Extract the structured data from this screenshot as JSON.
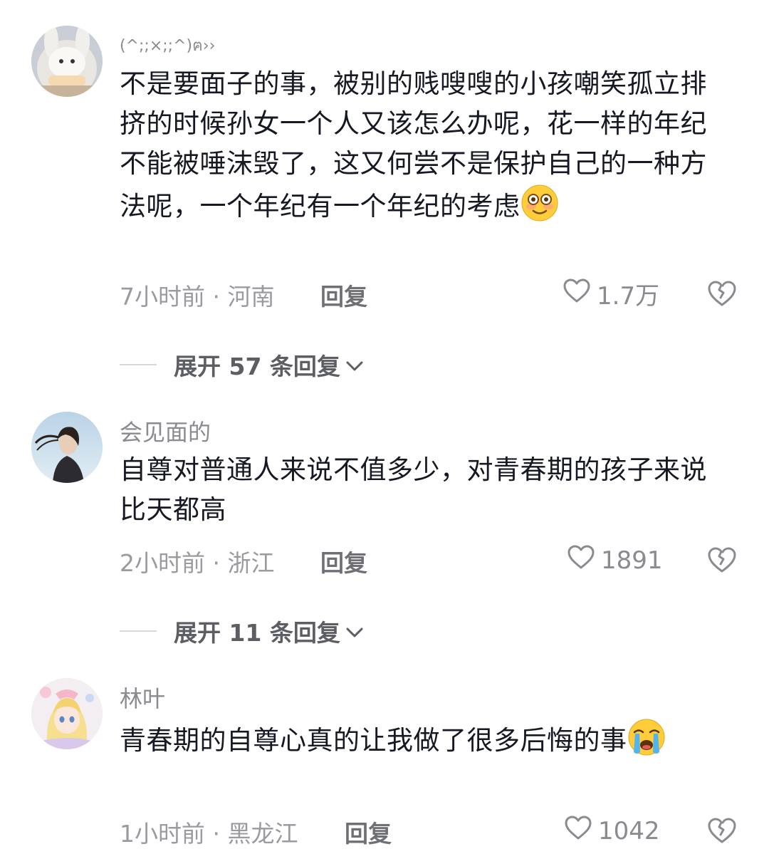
{
  "comments": [
    {
      "username": "(^;;×;;^)ฅ››",
      "text": "不是要面子的事，被别的贱嗖嗖的小孩嘲笑孤立排挤的时候孙女一个人又该怎么办呢，花一样的年纪不能被唾沫毁了，这又何尝不是保护自己的一种方法呢，一个年纪有一个年纪的考虑",
      "emoji": "flushed-face-emoji",
      "time": "7小时前",
      "separator": "·",
      "location": "河南",
      "reply_label": "回复",
      "likes": "1.7万",
      "expand_label": "展开 57 条回复"
    },
    {
      "username": "会见面的",
      "text": "自尊对普通人来说不值多少，对青春期的孩子来说比天都高",
      "time": "2小时前",
      "separator": "·",
      "location": "浙江",
      "reply_label": "回复",
      "likes": "1891",
      "expand_label": "展开 11 条回复"
    },
    {
      "username": "林叶",
      "text": "青春期的自尊心真的让我做了很多后悔的事",
      "emoji": "loudly-crying-face-emoji",
      "time": "1小时前",
      "separator": "·",
      "location": "黑龙江",
      "reply_label": "回复",
      "likes": "1042"
    }
  ],
  "icons": {
    "like": "heart-outline-icon",
    "dislike": "broken-heart-icon",
    "expand": "chevron-down-icon"
  },
  "colors": {
    "text_primary": "#161823",
    "text_secondary": "#8a8b91",
    "divider": "#d8d8db"
  }
}
